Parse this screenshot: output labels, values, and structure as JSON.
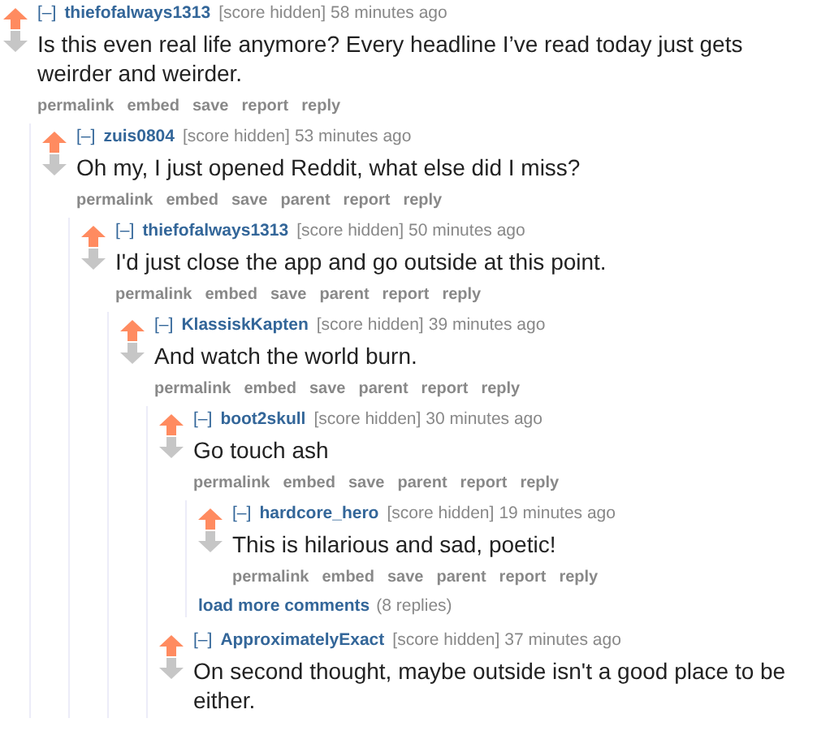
{
  "comments": [
    {
      "toggle": "[–]",
      "author": "thiefofalways1313",
      "score": "[score hidden]",
      "time": "58 minutes ago",
      "upvoted": true,
      "body": "Is this even real life anymore? Every headline I’ve read today just gets weirder and weirder.",
      "actions": [
        "permalink",
        "embed",
        "save",
        "report",
        "reply"
      ],
      "children": [
        {
          "toggle": "[–]",
          "author": "zuis0804",
          "score": "[score hidden]",
          "time": "53 minutes ago",
          "upvoted": true,
          "body": "Oh my, I just opened Reddit, what else did I miss?",
          "actions": [
            "permalink",
            "embed",
            "save",
            "parent",
            "report",
            "reply"
          ],
          "children": [
            {
              "toggle": "[–]",
              "author": "thiefofalways1313",
              "score": "[score hidden]",
              "time": "50 minutes ago",
              "upvoted": true,
              "body": "I'd just close the app and go outside at this point.",
              "actions": [
                "permalink",
                "embed",
                "save",
                "parent",
                "report",
                "reply"
              ],
              "children": [
                {
                  "toggle": "[–]",
                  "author": "KlassiskKapten",
                  "score": "[score hidden]",
                  "time": "39 minutes ago",
                  "upvoted": true,
                  "body": "And watch the world burn.",
                  "actions": [
                    "permalink",
                    "embed",
                    "save",
                    "parent",
                    "report",
                    "reply"
                  ],
                  "children": [
                    {
                      "toggle": "[–]",
                      "author": "boot2skull",
                      "score": "[score hidden]",
                      "time": "30 minutes ago",
                      "upvoted": true,
                      "body": "Go touch ash",
                      "actions": [
                        "permalink",
                        "embed",
                        "save",
                        "parent",
                        "report",
                        "reply"
                      ],
                      "children": [
                        {
                          "toggle": "[–]",
                          "author": "hardcore_hero",
                          "score": "[score hidden]",
                          "time": "19 minutes ago",
                          "upvoted": true,
                          "body": "This is hilarious and sad, poetic!",
                          "actions": [
                            "permalink",
                            "embed",
                            "save",
                            "parent",
                            "report",
                            "reply"
                          ]
                        }
                      ],
                      "more": {
                        "label": "load more comments",
                        "count": "(8 replies)"
                      }
                    },
                    {
                      "toggle": "[–]",
                      "author": "ApproximatelyExact",
                      "score": "[score hidden]",
                      "time": "37 minutes ago",
                      "upvoted": true,
                      "body": "On second thought, maybe outside isn't a good place to be either."
                    }
                  ]
                }
              ]
            }
          ]
        }
      ]
    }
  ]
}
